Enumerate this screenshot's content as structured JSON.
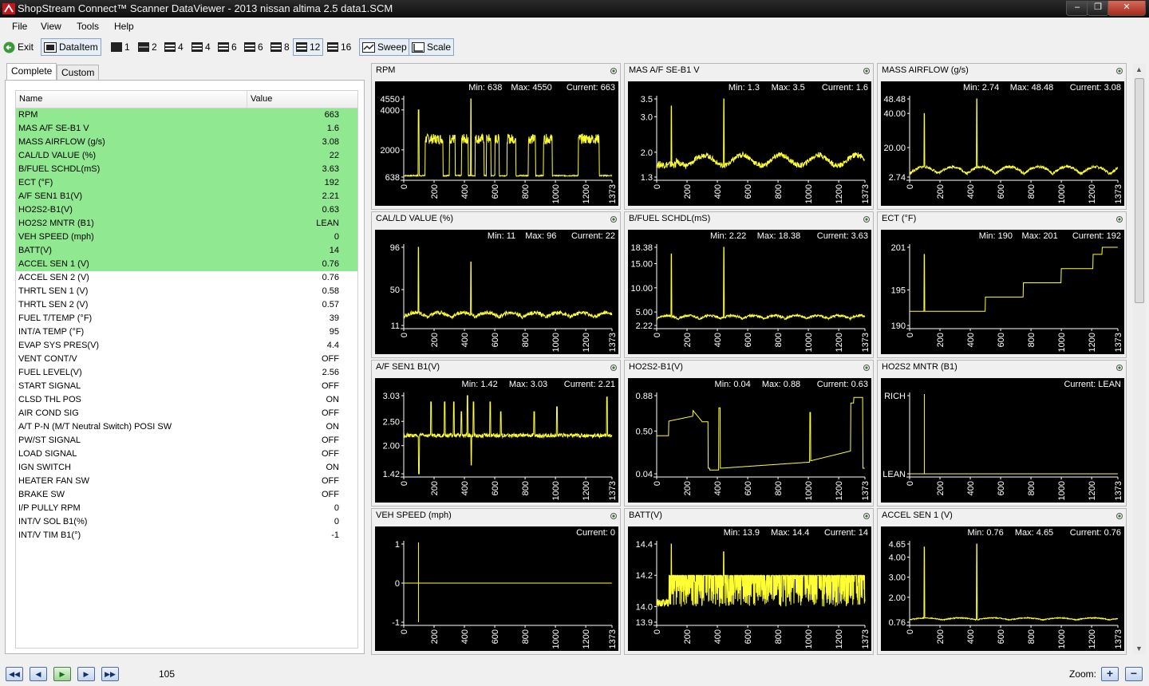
{
  "window": {
    "title": "ShopStream Connect™ Scanner DataViewer - 2013 nissan altima 2.5 data1.SCM"
  },
  "menu": [
    "File",
    "View",
    "Tools",
    "Help"
  ],
  "toolbar": {
    "exit": "Exit",
    "dataitem": "DataItem",
    "layouts": [
      "1",
      "2",
      "4",
      "4",
      "6",
      "6",
      "8",
      "12",
      "16"
    ],
    "sweep": "Sweep",
    "scale": "Scale"
  },
  "tabs": {
    "complete": "Complete",
    "custom": "Custom"
  },
  "table": {
    "headers": {
      "name": "Name",
      "value": "Value"
    },
    "rows": [
      {
        "name": "RPM",
        "value": "663",
        "hl": true
      },
      {
        "name": "MAS A/F SE-B1 V",
        "value": "1.6",
        "hl": true
      },
      {
        "name": "MASS AIRFLOW (g/s)",
        "value": "3.08",
        "hl": true
      },
      {
        "name": "CAL/LD VALUE (%)",
        "value": "22",
        "hl": true
      },
      {
        "name": "B/FUEL SCHDL(mS)",
        "value": "3.63",
        "hl": true
      },
      {
        "name": "ECT (°F)",
        "value": "192",
        "hl": true
      },
      {
        "name": "A/F SEN1 B1(V)",
        "value": "2.21",
        "hl": true
      },
      {
        "name": "HO2S2-B1(V)",
        "value": "0.63",
        "hl": true
      },
      {
        "name": "HO2S2 MNTR (B1)",
        "value": "LEAN",
        "hl": true
      },
      {
        "name": "VEH SPEED (mph)",
        "value": "0",
        "hl": true
      },
      {
        "name": "BATT(V)",
        "value": "14",
        "hl": true
      },
      {
        "name": "ACCEL SEN 1 (V)",
        "value": "0.76",
        "hl": true
      },
      {
        "name": "ACCEL SEN 2 (V)",
        "value": "0.76",
        "hl": false
      },
      {
        "name": "THRTL SEN 1 (V)",
        "value": "0.58",
        "hl": false
      },
      {
        "name": "THRTL SEN 2 (V)",
        "value": "0.57",
        "hl": false
      },
      {
        "name": "FUEL T/TEMP (°F)",
        "value": "39",
        "hl": false
      },
      {
        "name": "INT/A TEMP (°F)",
        "value": "95",
        "hl": false
      },
      {
        "name": "EVAP SYS PRES(V)",
        "value": "4.4",
        "hl": false
      },
      {
        "name": "VENT CONT/V",
        "value": "OFF",
        "hl": false
      },
      {
        "name": "FUEL LEVEL(V)",
        "value": "2.56",
        "hl": false
      },
      {
        "name": "START SIGNAL",
        "value": "OFF",
        "hl": false
      },
      {
        "name": "CLSD THL POS",
        "value": "ON",
        "hl": false
      },
      {
        "name": "AIR COND SIG",
        "value": "OFF",
        "hl": false
      },
      {
        "name": "A/T P-N (M/T Neutral Switch) POSI SW",
        "value": "ON",
        "hl": false
      },
      {
        "name": "PW/ST SIGNAL",
        "value": "OFF",
        "hl": false
      },
      {
        "name": "LOAD SIGNAL",
        "value": "OFF",
        "hl": false
      },
      {
        "name": "IGN SWITCH",
        "value": "ON",
        "hl": false
      },
      {
        "name": "HEATER FAN SW",
        "value": "OFF",
        "hl": false
      },
      {
        "name": "BRAKE SW",
        "value": "OFF",
        "hl": false
      },
      {
        "name": "I/P PULLY RPM",
        "value": "0",
        "hl": false
      },
      {
        "name": "INT/V SOL B1(%)",
        "value": "0",
        "hl": false
      },
      {
        "name": "INT/V TIM B1(°)",
        "value": "-1",
        "hl": false
      }
    ]
  },
  "chart_data": [
    {
      "type": "line",
      "title": "RPM",
      "min": "638",
      "max": "4550",
      "current": "663",
      "ylim": [
        638,
        4550
      ],
      "yticks": [
        "4550",
        "4000",
        "2000",
        "638"
      ],
      "ytickvals": [
        4550,
        4000,
        2000,
        638
      ],
      "xlim": [
        0,
        1373
      ],
      "xticks": [
        "0",
        "200",
        "400",
        "600",
        "800",
        "1000",
        "1200",
        "1373"
      ],
      "shape": "rpm"
    },
    {
      "type": "line",
      "title": "MAS A/F SE-B1 V",
      "min": "1.3",
      "max": "3.5",
      "current": "1.6",
      "ylim": [
        1.3,
        3.5
      ],
      "yticks": [
        "3.5",
        "3.0",
        "2.0",
        "1.3"
      ],
      "ytickvals": [
        3.5,
        3.0,
        2.0,
        1.3
      ],
      "xlim": [
        0,
        1373
      ],
      "xticks": [
        "0",
        "200",
        "400",
        "600",
        "800",
        "1000",
        "1200",
        "1373"
      ],
      "shape": "maf_v"
    },
    {
      "type": "line",
      "title": "MASS AIRFLOW (g/s)",
      "min": "2.74",
      "max": "48.48",
      "current": "3.08",
      "ylim": [
        2.74,
        48.48
      ],
      "yticks": [
        "48.48",
        "40.00",
        "20.00",
        "2.74"
      ],
      "ytickvals": [
        48.48,
        40,
        20,
        2.74
      ],
      "xlim": [
        0,
        1373
      ],
      "xticks": [
        "0",
        "200",
        "400",
        "600",
        "800",
        "1000",
        "1200",
        "1373"
      ],
      "shape": "maf"
    },
    {
      "type": "line",
      "title": "CAL/LD VALUE (%)",
      "min": "11",
      "max": "96",
      "current": "22",
      "ylim": [
        11,
        96
      ],
      "yticks": [
        "96",
        "50",
        "11"
      ],
      "ytickvals": [
        96,
        50,
        11
      ],
      "xlim": [
        0,
        1373
      ],
      "xticks": [
        "0",
        "200",
        "400",
        "600",
        "800",
        "1000",
        "1200",
        "1373"
      ],
      "shape": "load"
    },
    {
      "type": "line",
      "title": "B/FUEL SCHDL(mS)",
      "min": "2.22",
      "max": "18.38",
      "current": "3.63",
      "ylim": [
        2.22,
        18.38
      ],
      "yticks": [
        "18.38",
        "15.00",
        "10.00",
        "5.00",
        "2.22"
      ],
      "ytickvals": [
        18.38,
        15,
        10,
        5,
        2.22
      ],
      "xlim": [
        0,
        1373
      ],
      "xticks": [
        "0",
        "200",
        "400",
        "600",
        "800",
        "1000",
        "1200",
        "1373"
      ],
      "shape": "fuel"
    },
    {
      "type": "line",
      "title": "ECT (°F)",
      "min": "190",
      "max": "201",
      "current": "192",
      "ylim": [
        190,
        201
      ],
      "yticks": [
        "201",
        "195",
        "190"
      ],
      "ytickvals": [
        201,
        195,
        190
      ],
      "xlim": [
        0,
        1373
      ],
      "xticks": [
        "0",
        "200",
        "400",
        "600",
        "800",
        "1000",
        "1200",
        "1373"
      ],
      "shape": "ect"
    },
    {
      "type": "line",
      "title": "A/F SEN1 B1(V)",
      "min": "1.42",
      "max": "3.03",
      "current": "2.21",
      "ylim": [
        1.42,
        3.03
      ],
      "yticks": [
        "3.03",
        "2.50",
        "2.00",
        "1.42"
      ],
      "ytickvals": [
        3.03,
        2.5,
        2.0,
        1.42
      ],
      "xlim": [
        0,
        1373
      ],
      "xticks": [
        "0",
        "200",
        "400",
        "600",
        "800",
        "1000",
        "1200",
        "1373"
      ],
      "shape": "afs"
    },
    {
      "type": "line",
      "title": "HO2S2-B1(V)",
      "min": "0.04",
      "max": "0.88",
      "current": "0.63",
      "ylim": [
        0.04,
        0.88
      ],
      "yticks": [
        "0.88",
        "0.50",
        "0.04"
      ],
      "ytickvals": [
        0.88,
        0.5,
        0.04
      ],
      "xlim": [
        0,
        1373
      ],
      "xticks": [
        "0",
        "200",
        "400",
        "600",
        "800",
        "1000",
        "1200",
        "1373"
      ],
      "shape": "o2"
    },
    {
      "type": "line",
      "title": "HO2S2 MNTR (B1)",
      "current": "LEAN",
      "ylim": [
        0,
        1
      ],
      "yticks": [
        "RICH",
        "LEAN"
      ],
      "ytickvals": [
        1,
        0
      ],
      "xlim": [
        0,
        1373
      ],
      "xticks": [
        "0",
        "200",
        "400",
        "600",
        "800",
        "1000",
        "1200",
        "1373"
      ],
      "shape": "mntr"
    },
    {
      "type": "line",
      "title": "VEH SPEED (mph)",
      "current": "0",
      "ylim": [
        -1,
        1
      ],
      "yticks": [
        "1",
        "0",
        "-1"
      ],
      "ytickvals": [
        1,
        0,
        -1
      ],
      "xlim": [
        0,
        1373
      ],
      "xticks": [
        "0",
        "200",
        "400",
        "600",
        "800",
        "1000",
        "1200",
        "1373"
      ],
      "shape": "speed"
    },
    {
      "type": "line",
      "title": "BATT(V)",
      "min": "13.9",
      "max": "14.4",
      "current": "14",
      "ylim": [
        13.9,
        14.4
      ],
      "yticks": [
        "14.4",
        "14.2",
        "14.0",
        "13.9"
      ],
      "ytickvals": [
        14.4,
        14.2,
        14.0,
        13.9
      ],
      "xlim": [
        0,
        1373
      ],
      "xticks": [
        "0",
        "200",
        "400",
        "600",
        "800",
        "1000",
        "1200",
        "1373"
      ],
      "shape": "batt"
    },
    {
      "type": "line",
      "title": "ACCEL SEN 1 (V)",
      "min": "0.76",
      "max": "4.65",
      "current": "0.76",
      "ylim": [
        0.76,
        4.65
      ],
      "yticks": [
        "4.65",
        "4.00",
        "3.00",
        "2.00",
        "0.76"
      ],
      "ytickvals": [
        4.65,
        4,
        3,
        2,
        0.76
      ],
      "xlim": [
        0,
        1373
      ],
      "xticks": [
        "0",
        "200",
        "400",
        "600",
        "800",
        "1000",
        "1200",
        "1373"
      ],
      "shape": "accel"
    }
  ],
  "status": {
    "frame": "105",
    "zoom_label": "Zoom:"
  },
  "colors": {
    "plot_bg": "#000000",
    "trace": "#ffff33",
    "highlight": "#90e890"
  }
}
